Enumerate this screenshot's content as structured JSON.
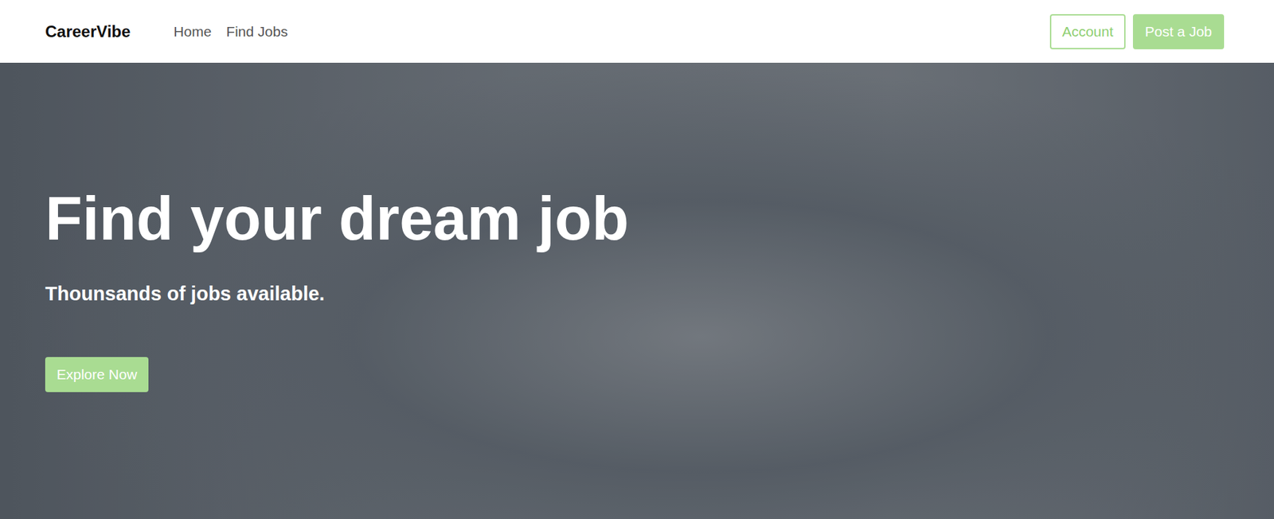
{
  "navbar": {
    "brand": "CareerVibe",
    "links": [
      {
        "label": "Home"
      },
      {
        "label": "Find Jobs"
      }
    ],
    "buttons": [
      {
        "label": "Account",
        "kind": "outline"
      },
      {
        "label": "Post a Job",
        "kind": "filled"
      }
    ]
  },
  "hero": {
    "title": "Find your dream job",
    "subtitle": "Thounsands of jobs available.",
    "cta": "Explore Now"
  }
}
